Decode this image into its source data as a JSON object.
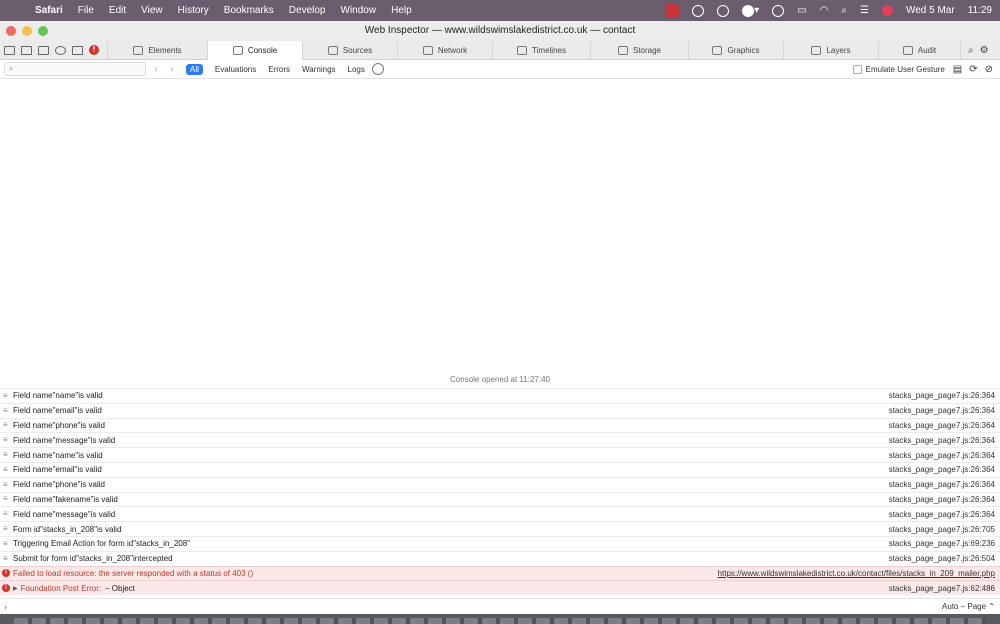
{
  "menubar": {
    "app": "Safari",
    "items": [
      "File",
      "Edit",
      "View",
      "History",
      "Bookmarks",
      "Develop",
      "Window",
      "Help"
    ],
    "date": "Wed 5 Mar",
    "time": "11:29"
  },
  "window": {
    "title": "Web Inspector — www.wildswimslakedistrict.co.uk — contact"
  },
  "tabs": [
    {
      "label": "Elements",
      "icon": "elements-icon"
    },
    {
      "label": "Console",
      "icon": "console-icon",
      "active": true
    },
    {
      "label": "Sources",
      "icon": "sources-icon"
    },
    {
      "label": "Network",
      "icon": "network-icon"
    },
    {
      "label": "Timelines",
      "icon": "timelines-icon"
    },
    {
      "label": "Storage",
      "icon": "storage-icon"
    },
    {
      "label": "Graphics",
      "icon": "graphics-icon"
    },
    {
      "label": "Layers",
      "icon": "layers-icon"
    },
    {
      "label": "Audit",
      "icon": "audit-icon"
    }
  ],
  "console_toolbar": {
    "filter_placeholder": "",
    "scopes": [
      "All",
      "Evaluations",
      "Errors",
      "Warnings",
      "Logs"
    ],
    "emulate_gesture": "Emulate User Gesture"
  },
  "console": {
    "opened_message": "Console opened at 11:27:40",
    "rows": [
      {
        "text": "Field name\"name\"is valid",
        "location": "stacks_page_page7.js:26:364",
        "level": "log"
      },
      {
        "text": "Field name\"email\"is valid",
        "location": "stacks_page_page7.js:26:364",
        "level": "log"
      },
      {
        "text": "Field name\"phone\"is valid",
        "location": "stacks_page_page7.js:26:364",
        "level": "log"
      },
      {
        "text": "Field name\"message\"is valid",
        "location": "stacks_page_page7.js:26:364",
        "level": "log"
      },
      {
        "text": "Field name\"name\"is valid",
        "location": "stacks_page_page7.js:26:364",
        "level": "log"
      },
      {
        "text": "Field name\"email\"is valid",
        "location": "stacks_page_page7.js:26:364",
        "level": "log"
      },
      {
        "text": "Field name\"phone\"is valid",
        "location": "stacks_page_page7.js:26:364",
        "level": "log"
      },
      {
        "text": "Field name\"fakename\"is valid",
        "location": "stacks_page_page7.js:26:364",
        "level": "log"
      },
      {
        "text": "Field name\"message\"is valid",
        "location": "stacks_page_page7.js:26:364",
        "level": "log"
      },
      {
        "text": "Form id\"stacks_in_208\"is valid",
        "location": "stacks_page_page7.js:26:705",
        "level": "log"
      },
      {
        "text": "Triggering Email Action for form id\"stacks_in_208\"",
        "location": "stacks_page_page7.js:69:236",
        "level": "log"
      },
      {
        "text": "Submit for form id\"stacks_in_208\"intercepted",
        "location": "stacks_page_page7.js:26:504",
        "level": "log"
      },
      {
        "text": "Failed to load resource: the server responded with a status of 403 ()",
        "location": "https://www.wildswimslakedistrict.co.uk/contact/files/stacks_in_209_mailer.php",
        "level": "error"
      },
      {
        "text": "Foundation Post Error:",
        "object": "– Object",
        "location": "stacks_page_page7.js:62:486",
        "level": "error"
      }
    ]
  },
  "prompt": {
    "context": "Auto – Page ⌃"
  }
}
